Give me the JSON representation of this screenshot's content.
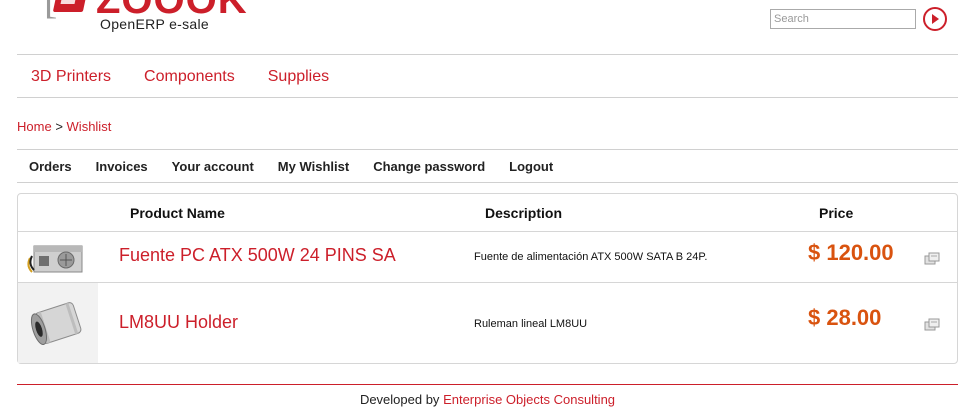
{
  "brand": {
    "logo_text": "ZOOOK",
    "subtitle": "OpenERP e-sale"
  },
  "search": {
    "placeholder": "Search",
    "value": ""
  },
  "categories": [
    {
      "label": "3D Printers"
    },
    {
      "label": "Components"
    },
    {
      "label": "Supplies"
    }
  ],
  "breadcrumb": {
    "home": "Home",
    "separator": ">",
    "current": "Wishlist"
  },
  "account_nav": [
    {
      "label": "Orders"
    },
    {
      "label": "Invoices"
    },
    {
      "label": "Your account"
    },
    {
      "label": "My Wishlist"
    },
    {
      "label": "Change password"
    },
    {
      "label": "Logout"
    }
  ],
  "wishlist_table": {
    "headers": {
      "product": "Product Name",
      "description": "Description",
      "price": "Price"
    },
    "rows": [
      {
        "image_icon": "power-supply-image",
        "name": "Fuente PC ATX 500W 24 PINS SA",
        "description": "Fuente de alimentación ATX 500W SATA B 24P.",
        "price": "$ 120.00"
      },
      {
        "image_icon": "linear-bearing-image",
        "name": "LM8UU Holder",
        "description": "Ruleman lineal LM8UU",
        "price": "$ 28.00"
      }
    ]
  },
  "footer": {
    "prefix": "Developed by",
    "link": "Enterprise Objects Consulting"
  },
  "colors": {
    "accent": "#cc1f2a",
    "price": "#d9530f"
  }
}
